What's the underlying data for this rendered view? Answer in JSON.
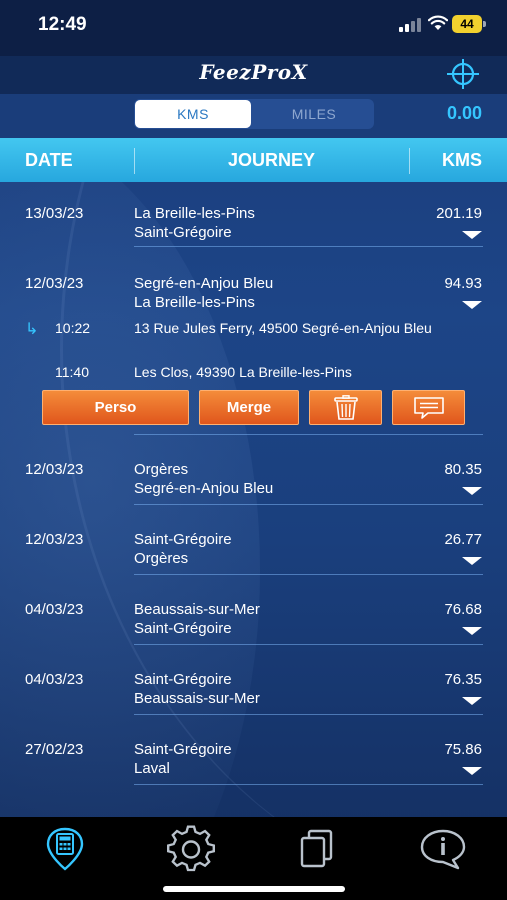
{
  "status": {
    "time": "12:49",
    "battery": "44"
  },
  "header": {
    "logo": "FeezProX"
  },
  "units": {
    "kms_label": "KMS",
    "miles_label": "MILES",
    "total": "0.00"
  },
  "columns": {
    "date": "DATE",
    "journey": "JOURNEY",
    "kms": "KMS"
  },
  "journeys": [
    {
      "date": "13/03/23",
      "from": "La Breille-les-Pins",
      "to": "Saint-Grégoire",
      "kms": "201.19"
    },
    {
      "date": "12/03/23",
      "from": "Segré-en-Anjou Bleu",
      "to": "La Breille-les-Pins",
      "kms": "94.93",
      "details": [
        {
          "time": "10:22",
          "address": "13 Rue Jules Ferry, 49500 Segré-en-Anjou Bleu"
        },
        {
          "time": "11:40",
          "address": "Les Clos, 49390 La Breille-les-Pins"
        }
      ],
      "actions": {
        "perso": "Perso",
        "merge": "Merge"
      }
    },
    {
      "date": "12/03/23",
      "from": "Orgères",
      "to": "Segré-en-Anjou Bleu",
      "kms": "80.35"
    },
    {
      "date": "12/03/23",
      "from": "Saint-Grégoire",
      "to": "Orgères",
      "kms": "26.77"
    },
    {
      "date": "04/03/23",
      "from": "Beaussais-sur-Mer",
      "to": "Saint-Grégoire",
      "kms": "76.68"
    },
    {
      "date": "04/03/23",
      "from": "Saint-Grégoire",
      "to": "Beaussais-sur-Mer",
      "kms": "76.35"
    },
    {
      "date": "27/02/23",
      "from": "Saint-Grégoire",
      "to": "Laval",
      "kms": "75.86"
    }
  ],
  "tabs": [
    {
      "icon": "calculator-location-icon",
      "active": true
    },
    {
      "icon": "gear-icon",
      "active": false
    },
    {
      "icon": "copy-icon",
      "active": false
    },
    {
      "icon": "info-bubble-icon",
      "active": false
    }
  ],
  "colors": {
    "accent": "#35c6ff",
    "header": "#2fb3e6",
    "action": "#ea6f28"
  }
}
